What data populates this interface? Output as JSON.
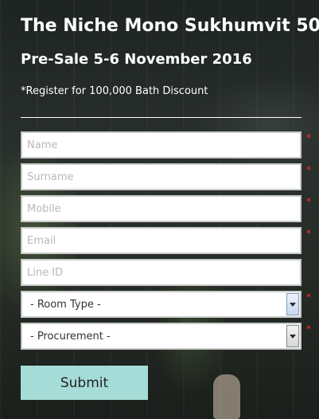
{
  "header": {
    "title": "The Niche Mono Sukhumvit 50",
    "subtitle": "Pre-Sale 5-6 November 2016",
    "note": "*Register for 100,000 Bath Discount"
  },
  "form": {
    "name_placeholder": "Name",
    "surname_placeholder": "Surname",
    "mobile_placeholder": "Mobile",
    "email_placeholder": "Email",
    "line_id_placeholder": "Line ID",
    "room_type_value": "- Room Type -",
    "procurement_value": "- Procurement -",
    "required_marker": "*",
    "submit_label": "Submit"
  },
  "colors": {
    "accent": "#a5dcd8",
    "required": "#ff2a2a",
    "text": "#ffffff"
  },
  "icons": {
    "dropdown": "chevron-down-icon"
  }
}
